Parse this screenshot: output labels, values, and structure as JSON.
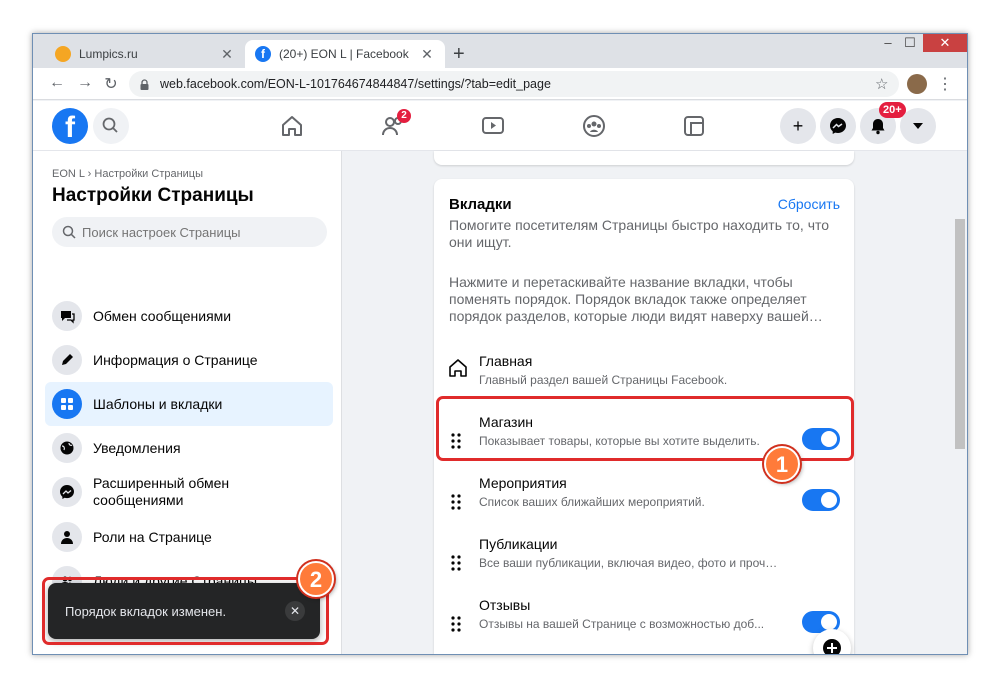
{
  "browser": {
    "tabs": [
      {
        "title": "Lumpics.ru",
        "favicon_color": "#f5a623"
      },
      {
        "title": "(20+) EON L | Facebook",
        "favicon_color": "#1877f2"
      }
    ],
    "url": "web.facebook.com/EON-L-101764674844847/settings/?tab=edit_page"
  },
  "fb_nav": {
    "friends_badge": "2",
    "notifications_badge": "20+"
  },
  "sidebar": {
    "breadcrumb": "EON L › Настройки Страницы",
    "title": "Настройки Страницы",
    "search_placeholder": "Поиск настроек Страницы",
    "items": [
      {
        "label": "Обмен сообщениями",
        "icon": "chat-icon"
      },
      {
        "label": "Информация о Странице",
        "icon": "pencil-icon"
      },
      {
        "label": "Шаблоны и вкладки",
        "icon": "grid-icon",
        "selected": true
      },
      {
        "label": "Уведомления",
        "icon": "globe-icon"
      },
      {
        "label": "Расширенный обмен сообщениями",
        "icon": "messenger-icon"
      },
      {
        "label": "Роли на Странице",
        "icon": "person-icon"
      },
      {
        "label": "Люди и другие Страницы",
        "icon": "people-icon"
      }
    ]
  },
  "main": {
    "tabs_card": {
      "title": "Вкладки",
      "reset_label": "Сбросить",
      "description1": "Помогите посетителям Страницы быстро находить то, что они ищут.",
      "description2": "Нажмите и перетаскивайте название вкладки, чтобы поменять порядок. Порядок вкладок также определяет порядок разделов, которые люди видят наверху вашей…",
      "rows": [
        {
          "title": "Главная",
          "subtitle": "Главный раздел вашей Страницы Facebook.",
          "toggle": null
        },
        {
          "title": "Магазин",
          "subtitle": "Показывает товары, которые вы хотите выделить.",
          "toggle": true
        },
        {
          "title": "Мероприятия",
          "subtitle": "Список ваших ближайших мероприятий.",
          "toggle": true
        },
        {
          "title": "Публикации",
          "subtitle": "Все ваши публикации, включая видео, фото и прочее.",
          "toggle": null
        },
        {
          "title": "Отзывы",
          "subtitle": "Отзывы на вашей Странице с возможностью доб...",
          "toggle": true
        }
      ]
    }
  },
  "toast": {
    "message": "Порядок вкладок изменен."
  },
  "annotations": [
    "1",
    "2"
  ]
}
